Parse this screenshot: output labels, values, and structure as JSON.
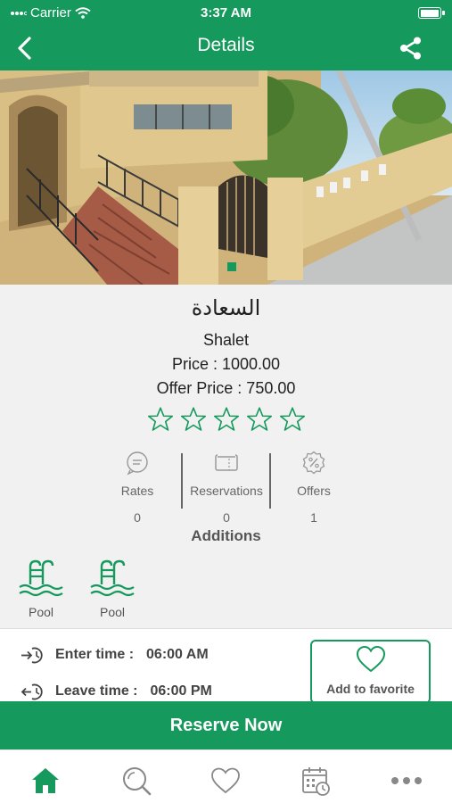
{
  "status_bar": {
    "carrier": "Carrier",
    "time": "3:37 AM"
  },
  "nav": {
    "title": "Details"
  },
  "property": {
    "name": "السعادة",
    "type": "Shalet",
    "price_label": "Price : 1000.00",
    "offer_label": "Offer Price : 750.00",
    "rating": 0,
    "rating_max": 5
  },
  "stats": [
    {
      "label": "Rates",
      "count": "0",
      "icon": "chat-icon"
    },
    {
      "label": "Reservations",
      "count": "0",
      "icon": "ticket-icon"
    },
    {
      "label": "Offers",
      "count": "1",
      "icon": "percent-badge-icon"
    }
  ],
  "additions": {
    "title": "Additions",
    "items": [
      {
        "label": "Pool",
        "icon": "pool-icon"
      },
      {
        "label": "Pool",
        "icon": "pool-icon"
      }
    ]
  },
  "times": {
    "enter_label": "Enter time :",
    "enter_value": "06:00 AM",
    "leave_label": "Leave time :",
    "leave_value": "06:00 PM"
  },
  "favorite": {
    "label": "Add to favorite"
  },
  "reserve": {
    "label": "Reserve Now"
  },
  "tabs": [
    {
      "name": "home-icon",
      "active": true
    },
    {
      "name": "search-icon",
      "active": false
    },
    {
      "name": "heart-icon",
      "active": false
    },
    {
      "name": "calendar-icon",
      "active": false
    },
    {
      "name": "more-icon",
      "active": false
    }
  ],
  "colors": {
    "primary": "#16995c",
    "star": "#16995c",
    "muted": "#888888"
  }
}
